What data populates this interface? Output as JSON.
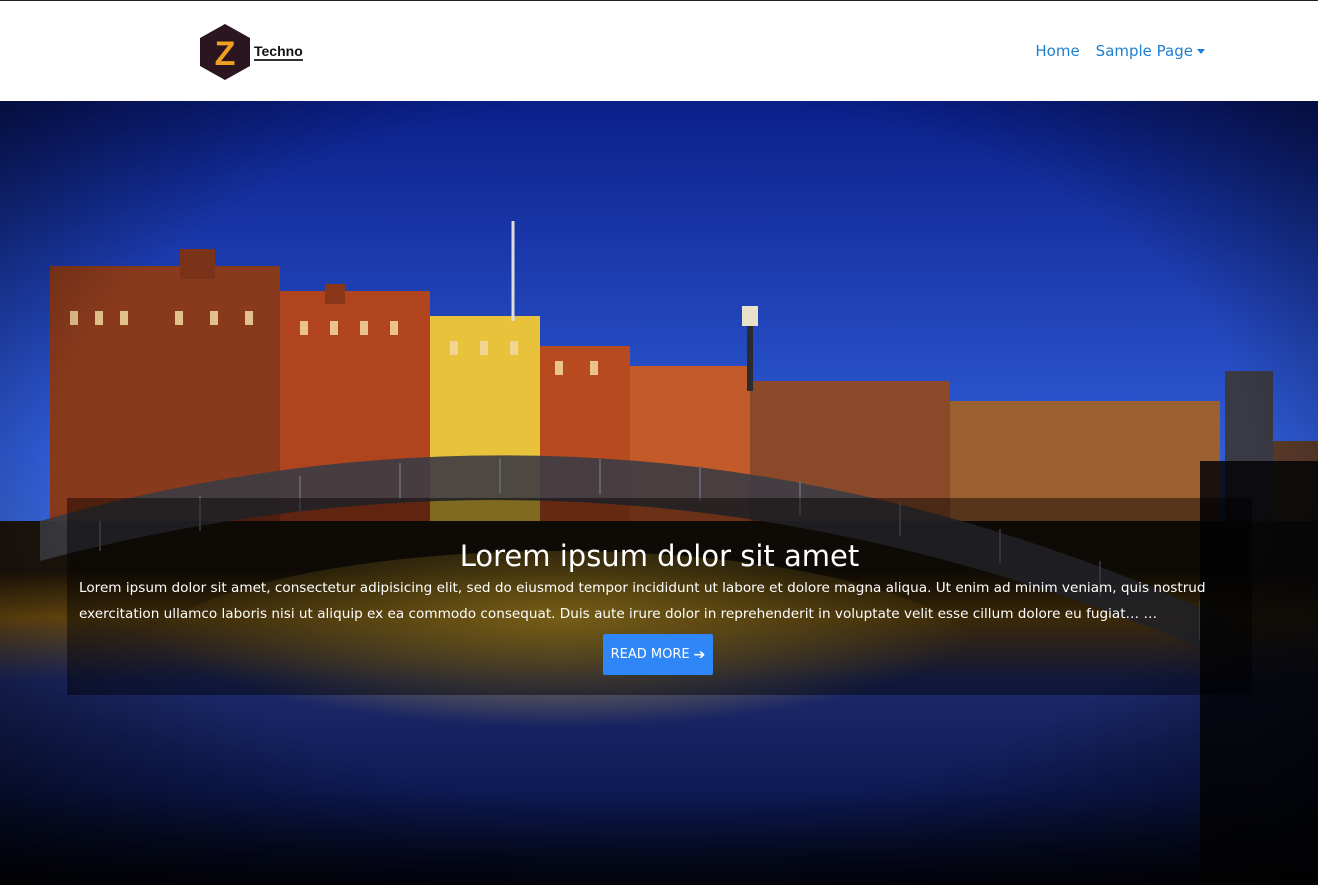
{
  "navbar": {
    "brand": {
      "logo_letter": "Z",
      "name": "Techno"
    },
    "items": [
      {
        "label": "Home"
      },
      {
        "label": "Sample Page",
        "has_dropdown": true
      }
    ]
  },
  "hero": {
    "image": "dublin-bridge-photo",
    "caption": {
      "title": "Lorem ipsum dolor sit amet",
      "text": "Lorem ipsum dolor sit amet, consectetur adipisicing elit, sed do eiusmod tempor incididunt ut labore et dolore magna aliqua. Ut enim ad minim veniam, quis nostrud exercitation ullamco laboris nisi ut aliquip ex ea commodo consequat. Duis aute irure dolor in reprehenderit in voluptate velit esse cillum dolore eu fugiat… …",
      "button_label": "READ MORE",
      "button_icon": "arrow-right-icon"
    }
  },
  "colors": {
    "link": "#1e7fd1",
    "button": "#2f86f6",
    "logo_bg": "#2a1520",
    "logo_letter": "#f0a020"
  }
}
